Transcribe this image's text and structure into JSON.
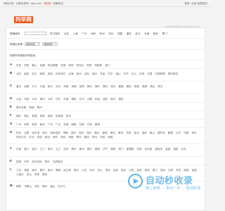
{
  "topbar": {
    "left_text": "网站分类 · 分类信息网 · laipu.com",
    "left_tag": "【首页】",
    "left_extra": "收藏本站",
    "right_text": "登录 | 注册  免费发布"
  },
  "header": {
    "logo": "列举网",
    "slogan": "免费发布分类信息 本地生活信息平台"
  },
  "search": {
    "label": "搜索城市:",
    "placeholder": "",
    "icon": "search-icon"
  },
  "hot_cities": [
    "热门城市",
    "北京",
    "上海",
    "广州",
    "深圳",
    "杭州",
    "苏州",
    "成都",
    "重庆",
    "武汉",
    "天津",
    "西安",
    "厦门"
  ],
  "selector": {
    "label": "按省份选择:",
    "province": "选择省份",
    "city": "选择城市"
  },
  "az_label": "按城市拼音首字母查找:",
  "letters": [
    {
      "letter": "A",
      "cities": [
        "安庆",
        "安阳",
        "鞍山",
        "安康",
        "阿拉善盟",
        "安顺",
        "阿坝",
        "阿克苏",
        "阿里",
        "阿勒泰",
        "澳门"
      ]
    },
    {
      "letter": "B",
      "cities": [
        "北京",
        "保定",
        "包头",
        "蚌埠",
        "宝鸡",
        "巴彦淖尔",
        "北海",
        "滨州",
        "百色",
        "亳州",
        "本溪",
        "巴中",
        "保山",
        "毕节",
        "白山",
        "白城",
        "白银",
        "巴音郭楞",
        "博尔塔拉"
      ]
    },
    {
      "letter": "C",
      "cities": [
        "重庆",
        "成都",
        "长沙",
        "长春",
        "常州",
        "沧州",
        "赤峰",
        "承德",
        "常德",
        "郴州",
        "潮州",
        "滁州",
        "池州",
        "巢湖",
        "朝阳",
        "楚雄",
        "昌都",
        "昌吉",
        "崇左"
      ]
    },
    {
      "letter": "D",
      "cities": [
        "大连",
        "东莞",
        "大庆",
        "德州",
        "大同",
        "丹东",
        "东营",
        "德阳",
        "达州",
        "大理",
        "定西",
        "迪庆",
        "儋州",
        "德宏"
      ]
    },
    {
      "letter": "E",
      "cities": [
        "鄂尔多斯",
        "恩施",
        "鄂州"
      ]
    },
    {
      "letter": "F",
      "cities": [
        "福州",
        "佛山",
        "抚顺",
        "阜阳",
        "阜新",
        "防城港",
        "抚州"
      ]
    },
    {
      "letter": "G",
      "cities": [
        "广州",
        "贵阳",
        "桂林",
        "赣州",
        "广安",
        "广元",
        "贵港",
        "固原",
        "甘南",
        "甘孜",
        "果洛"
      ]
    },
    {
      "letter": "H",
      "cities": [
        "杭州",
        "合肥",
        "哈尔滨",
        "海口",
        "呼和浩特",
        "邯郸",
        "湖州",
        "淮安",
        "惠州",
        "衡水",
        "衡阳",
        "黄石",
        "黄冈",
        "菏泽",
        "淮北",
        "淮南",
        "黄山",
        "葫芦岛",
        "鹤壁",
        "汉中",
        "河源",
        "怀化",
        "呼伦贝尔",
        "红河",
        "哈密",
        "和田",
        "海东",
        "海北",
        "海西",
        "黑河",
        "鹤岗",
        "贺州",
        "河池",
        "海南"
      ]
    },
    {
      "letter": "J",
      "cities": [
        "济南",
        "嘉兴",
        "金华",
        "江门",
        "荆州",
        "九江",
        "吉林",
        "焦作",
        "锦州",
        "晋中",
        "晋城",
        "济宁",
        "揭阳",
        "荆门",
        "景德镇",
        "鸡西",
        "佳木斯",
        "嘉峪关",
        "金昌",
        "酒泉",
        "吉安"
      ]
    },
    {
      "letter": "K",
      "cities": [
        "昆明",
        "开封",
        "克拉玛依",
        "喀什",
        "克孜勒苏"
      ]
    },
    {
      "letter": "L",
      "cities": [
        "兰州",
        "洛阳",
        "临沂",
        "廊坊",
        "柳州",
        "聊城",
        "连云港",
        "丽水",
        "六安",
        "泸州",
        "乐山",
        "漯河",
        "吕梁",
        "临汾",
        "辽阳",
        "龙岩",
        "娄底",
        "丽江",
        "临沧",
        "拉萨",
        "林芝",
        "陇南",
        "临夏",
        "六盘水",
        "凉山",
        "来宾",
        "莱芜"
      ]
    },
    {
      "letter": "M",
      "cities": [
        "绵阳",
        "马鞍山",
        "茂名",
        "梅州",
        "眉山",
        "牡丹江"
      ]
    }
  ],
  "watermark": {
    "title": "自动秒收录",
    "sub": "做上链接 → 来访一次 → 自动收录"
  }
}
